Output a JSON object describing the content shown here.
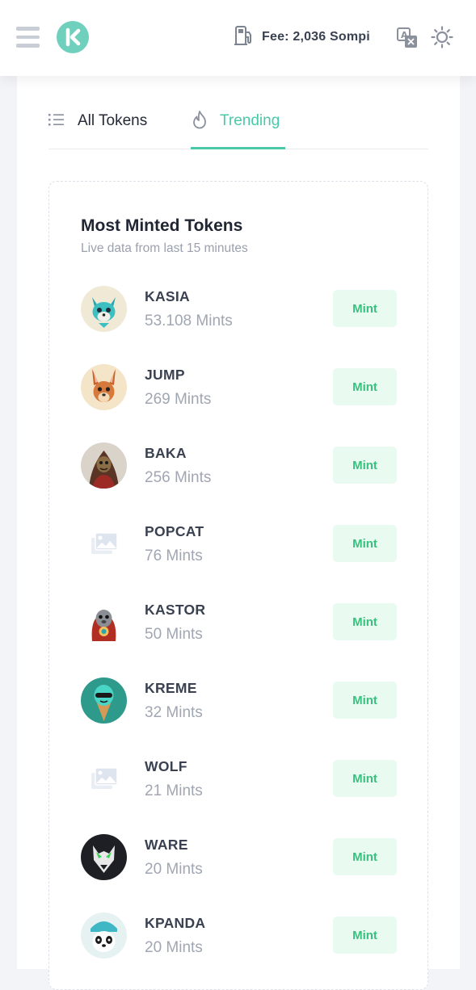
{
  "header": {
    "menu_icon": "hamburger-menu-icon",
    "logo_icon": "kaspa-logo-icon",
    "fee_icon": "gas-pump-icon",
    "fee_label": "Fee: 2,036 Sompi",
    "translate_icon": "translate-icon",
    "theme_icon": "sun-icon"
  },
  "tabs": [
    {
      "label": "All Tokens",
      "icon": "list-icon",
      "active": false
    },
    {
      "label": "Trending",
      "icon": "flame-icon",
      "active": true
    }
  ],
  "colors": {
    "accent": "#49c9a9",
    "mint_button_bg": "#e9fbf1",
    "mint_button_text": "#39c07f"
  },
  "card": {
    "title": "Most Minted Tokens",
    "subtitle": "Live data from last 15 minutes",
    "mint_label": "Mint",
    "tokens": [
      {
        "name": "KASIA",
        "mints": "53.108 Mints",
        "avatar": "fox-avatar"
      },
      {
        "name": "JUMP",
        "mints": "269 Mints",
        "avatar": "kangaroo-avatar"
      },
      {
        "name": "BAKA",
        "mints": "256 Mints",
        "avatar": "hooded-creature-avatar"
      },
      {
        "name": "POPCAT",
        "mints": "76 Mints",
        "avatar": "image-placeholder-icon"
      },
      {
        "name": "KASTOR",
        "mints": "50 Mints",
        "avatar": "beaver-avatar"
      },
      {
        "name": "KREME",
        "mints": "32 Mints",
        "avatar": "ice-cream-avatar"
      },
      {
        "name": "WOLF",
        "mints": "21 Mints",
        "avatar": "image-placeholder-icon"
      },
      {
        "name": "WARE",
        "mints": "20 Mints",
        "avatar": "wolf-avatar"
      },
      {
        "name": "KPANDA",
        "mints": "20 Mints",
        "avatar": "panda-avatar"
      }
    ]
  }
}
